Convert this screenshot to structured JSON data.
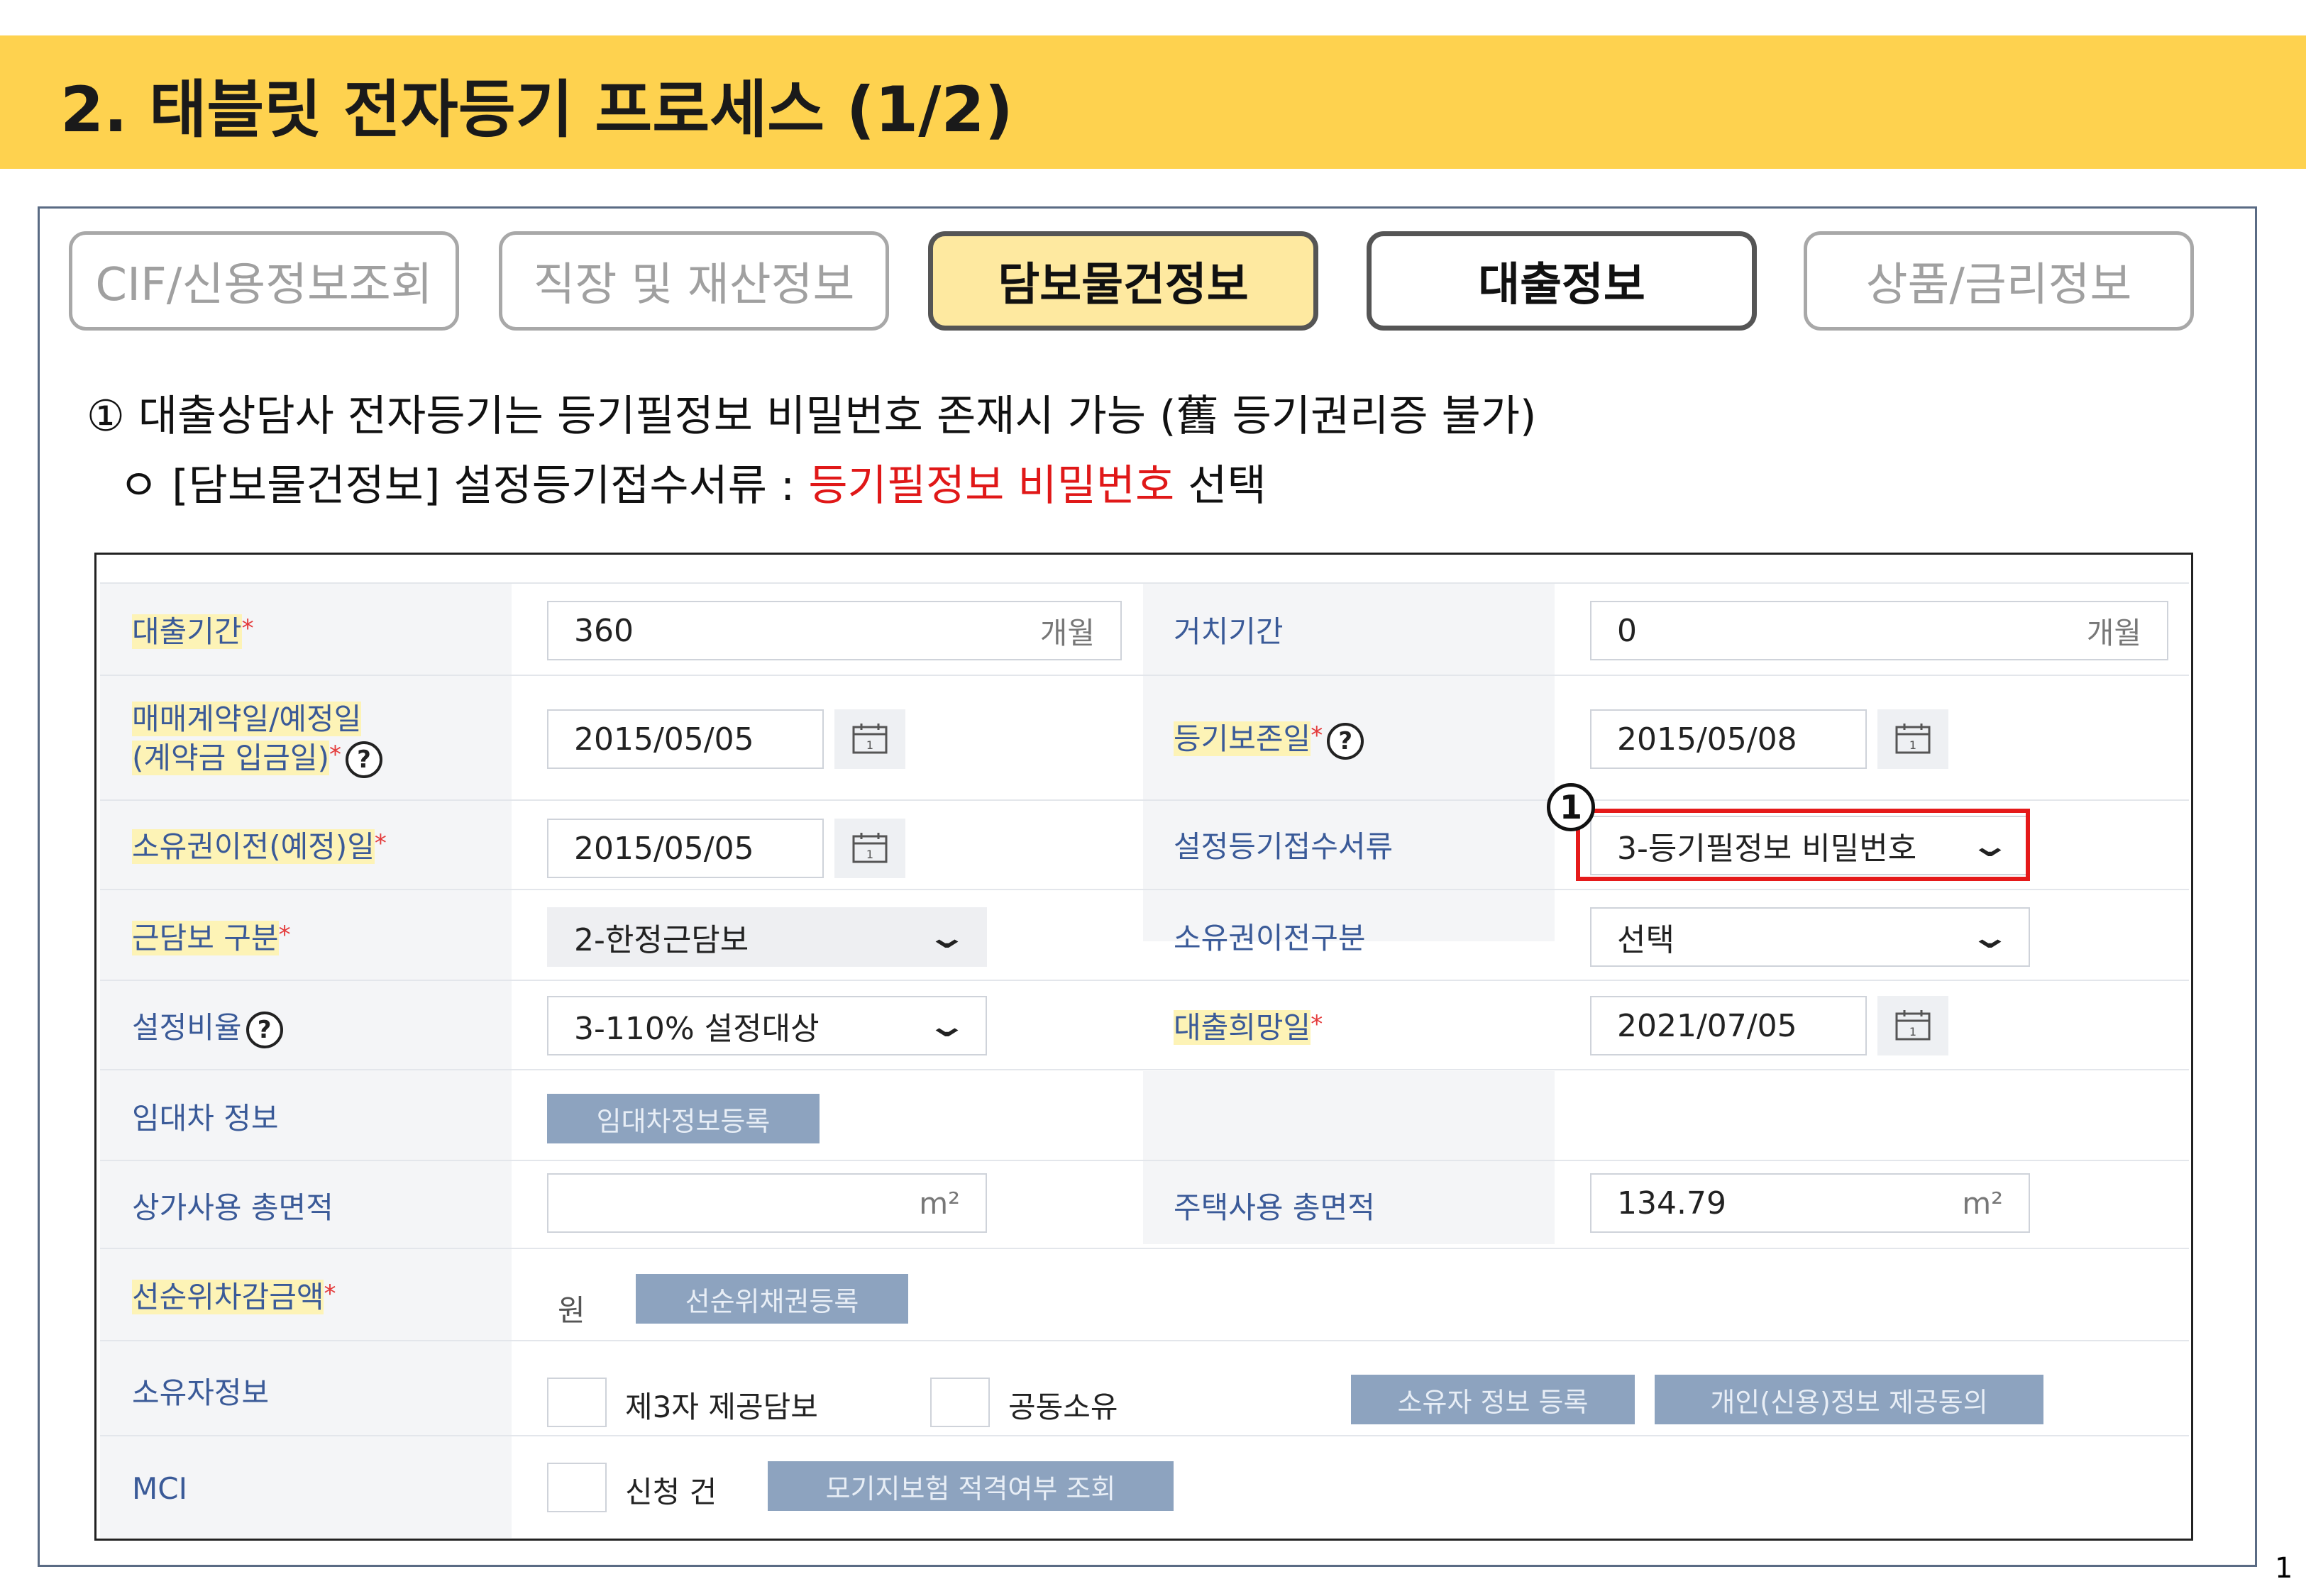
{
  "title": "2. 태블릿 전자등기 프로세스 (1/2)",
  "page_number": "1",
  "tabs": [
    {
      "label": "CIF/신용정보조회",
      "state": "inactive"
    },
    {
      "label": "직장 및 재산정보",
      "state": "inactive"
    },
    {
      "label": "담보물건정보",
      "state": "active"
    },
    {
      "label": "대출정보",
      "state": "current"
    },
    {
      "label": "상품/금리정보",
      "state": "inactive"
    }
  ],
  "description": {
    "line1": "① 대출상담사 전자등기는 등기필정보 비밀번호 존재시 가능 (舊 등기권리증 불가)",
    "line2_prefix": "ㅇ [담보물건정보] 설정등기접수서류 : ",
    "line2_highlight": "등기필정보 비밀번호",
    "line2_suffix": " 선택"
  },
  "form": {
    "loan_period": {
      "label": "대출기간",
      "value": "360",
      "unit": "개월"
    },
    "grace_period": {
      "label": "거치기간",
      "value": "0",
      "unit": "개월"
    },
    "contract_date": {
      "label_line1": "매매계약일/예정일",
      "label_line2": "(계약금 입금일)",
      "value": "2015/05/05"
    },
    "registry_date": {
      "label": "등기보존일",
      "value": "2015/05/08"
    },
    "ownership_transfer_date": {
      "label": "소유권이전(예정)일",
      "value": "2015/05/05"
    },
    "registration_docs": {
      "label": "설정등기접수서류",
      "value": "3-등기필정보 비밀번호"
    },
    "collateral_type": {
      "label": "근담보 구분",
      "value": "2-한정근담보"
    },
    "ownership_transfer_type": {
      "label": "소유권이전구분",
      "value": "선택"
    },
    "setting_ratio": {
      "label": "설정비율",
      "value": "3-110% 설정대상"
    },
    "desired_loan_date": {
      "label": "대출희망일",
      "value": "2021/07/05"
    },
    "lease_info": {
      "label": "임대차 정보",
      "button": "임대차정보등록"
    },
    "commercial_area": {
      "label": "상가사용 총면적",
      "value": "",
      "unit": "m²"
    },
    "residential_area": {
      "label": "주택사용 총면적",
      "value": "134.79",
      "unit": "m²"
    },
    "senior_deduction": {
      "label": "선순위차감금액",
      "unit": "원",
      "button": "선순위채권등록"
    },
    "owner_info": {
      "label": "소유자정보",
      "check1": "제3자 제공담보",
      "check2": "공동소유",
      "button1": "소유자 정보 등록",
      "button2": "개인(신용)정보 제공동의"
    },
    "mci": {
      "label": "MCI",
      "check": "신청 건",
      "button": "모기지보험 적격여부 조회"
    }
  },
  "annotation_marker": "1",
  "colors": {
    "title_bar": "#fed24f",
    "active_tab": "#fee9a0",
    "highlight": "#e01818",
    "field_label": "#3a5a98"
  }
}
